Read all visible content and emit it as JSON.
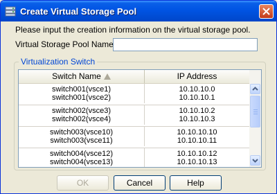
{
  "window": {
    "title": "Create Virtual Storage Pool",
    "icon": "storage-pool-app-icon"
  },
  "form": {
    "instructions": "Please input the creation information on the virtual storage pool.",
    "name_label": "Virtual Storage Pool Name",
    "name_value": ""
  },
  "group": {
    "label": "Virtualization Switch",
    "columns": [
      "Switch Name",
      "IP Address"
    ],
    "sort_icon": "sort-ascending-icon",
    "rows": [
      {
        "names": [
          "switch001(vsce1)",
          "switch001(vsce2)"
        ],
        "ips": [
          "10.10.10.0",
          "10.10.10.1"
        ]
      },
      {
        "names": [
          "switch002(vsce3)",
          "switch002(vsce4)"
        ],
        "ips": [
          "10.10.10.2",
          "10.10.10.3"
        ]
      },
      {
        "names": [
          "switch003(vsce10)",
          "switch003(vsce11)"
        ],
        "ips": [
          "10.10.10.10",
          "10.10.10.11"
        ]
      },
      {
        "names": [
          "switch004(vsce12)",
          "switch004(vsce13)"
        ],
        "ips": [
          "10.10.10.12",
          "10.10.10.13"
        ]
      }
    ]
  },
  "buttons": {
    "ok": "OK",
    "cancel": "Cancel",
    "help": "Help"
  },
  "colors": {
    "titlebar": "#0054e3",
    "group_label": "#0046d5",
    "disabled_text": "#aca899"
  }
}
